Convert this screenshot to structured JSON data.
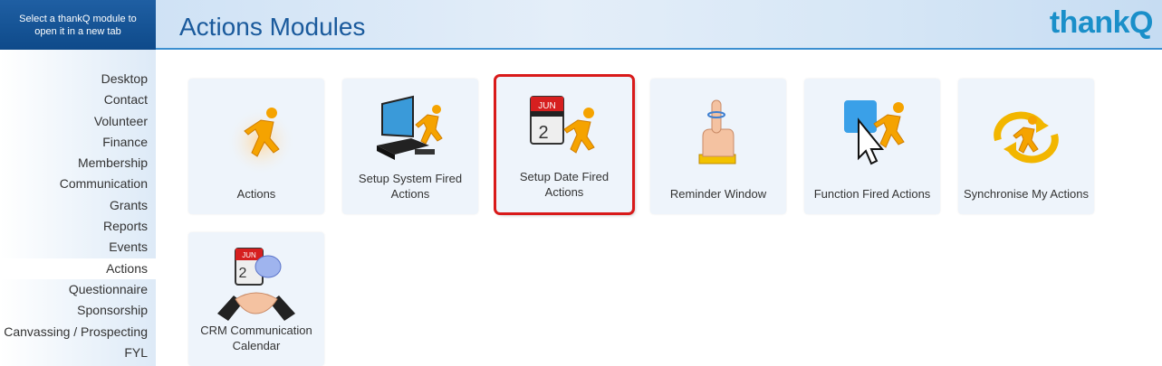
{
  "side_header": {
    "text": "Select a thankQ module to open it in a new tab"
  },
  "banner": {
    "title": "Actions Modules",
    "logo": "thank",
    "logo_q": "Q"
  },
  "nav": [
    "Desktop",
    "Contact",
    "Volunteer",
    "Finance",
    "Membership",
    "Communication",
    "Grants",
    "Reports",
    "Events",
    "Actions",
    "Questionnaire",
    "Sponsorship",
    "Canvassing / Prospecting",
    "FYL"
  ],
  "nav_active": "Actions",
  "tiles": [
    {
      "label": "Actions",
      "icon": "running-man-icon"
    },
    {
      "label": "Setup System Fired Actions",
      "icon": "computer-running-man-icon"
    },
    {
      "label": "Setup Date Fired Actions",
      "icon": "calendar-running-man-icon",
      "calendar_month": "JUN",
      "calendar_day": "2"
    },
    {
      "label": "Reminder Window",
      "icon": "finger-string-icon"
    },
    {
      "label": "Function Fired Actions",
      "icon": "pointer-running-man-icon"
    },
    {
      "label": "Synchronise My Actions",
      "icon": "sync-running-man-icon"
    },
    {
      "label": "CRM Communication Calendar",
      "icon": "calendar-handshake-icon",
      "calendar_month": "JUN",
      "calendar_day": "2"
    }
  ],
  "colors": {
    "accent": "#1a5a9c",
    "selected_border": "#d91a1a",
    "runner": "#f5a300"
  }
}
